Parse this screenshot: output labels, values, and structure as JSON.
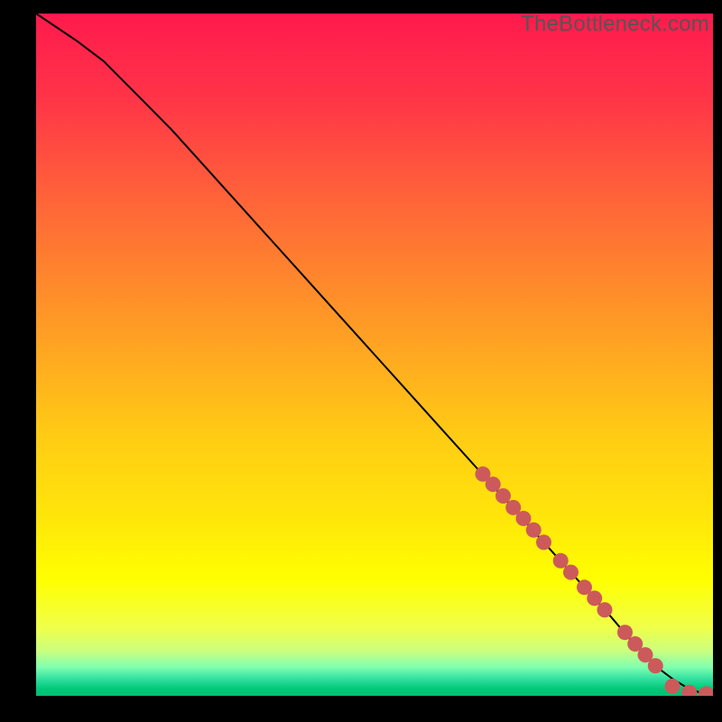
{
  "watermark": "TheBottleneck.com",
  "gradient_stops": [
    {
      "offset": 0.0,
      "color": "#ff1a4d"
    },
    {
      "offset": 0.12,
      "color": "#ff3348"
    },
    {
      "offset": 0.28,
      "color": "#ff6638"
    },
    {
      "offset": 0.45,
      "color": "#ff9926"
    },
    {
      "offset": 0.62,
      "color": "#ffcc14"
    },
    {
      "offset": 0.74,
      "color": "#ffe60a"
    },
    {
      "offset": 0.83,
      "color": "#ffff00"
    },
    {
      "offset": 0.9,
      "color": "#f0ff4a"
    },
    {
      "offset": 0.935,
      "color": "#c8ff80"
    },
    {
      "offset": 0.958,
      "color": "#80ffb0"
    },
    {
      "offset": 0.975,
      "color": "#33e0a0"
    },
    {
      "offset": 0.99,
      "color": "#00c878"
    },
    {
      "offset": 1.0,
      "color": "#00bf73"
    }
  ],
  "chart_data": {
    "type": "line",
    "title": "",
    "xlabel": "",
    "ylabel": "",
    "xlim": [
      0,
      100
    ],
    "ylim": [
      0,
      100
    ],
    "series": [
      {
        "name": "curve",
        "x": [
          0,
          3,
          6,
          10,
          15,
          20,
          25,
          30,
          35,
          40,
          45,
          50,
          55,
          60,
          65,
          70,
          75,
          80,
          85,
          88,
          90,
          92,
          94,
          96,
          98,
          100
        ],
        "y": [
          100,
          98,
          96,
          93,
          88,
          83,
          77.5,
          72,
          66.5,
          61,
          55.5,
          50,
          44.5,
          39,
          33.5,
          28,
          22.5,
          17,
          11.5,
          8,
          6,
          4,
          2.5,
          1.3,
          0.5,
          0.2
        ]
      }
    ],
    "markers": [
      {
        "x": 66,
        "y": 32.5
      },
      {
        "x": 67.5,
        "y": 31
      },
      {
        "x": 69,
        "y": 29.3
      },
      {
        "x": 70.5,
        "y": 27.6
      },
      {
        "x": 72,
        "y": 26
      },
      {
        "x": 73.5,
        "y": 24.3
      },
      {
        "x": 75,
        "y": 22.5
      },
      {
        "x": 77.5,
        "y": 19.8
      },
      {
        "x": 79,
        "y": 18.1
      },
      {
        "x": 81,
        "y": 15.9
      },
      {
        "x": 82.5,
        "y": 14.3
      },
      {
        "x": 84,
        "y": 12.6
      },
      {
        "x": 87,
        "y": 9.3
      },
      {
        "x": 88.5,
        "y": 7.6
      },
      {
        "x": 90,
        "y": 6
      },
      {
        "x": 91.5,
        "y": 4.4
      },
      {
        "x": 94,
        "y": 1.4
      },
      {
        "x": 96.5,
        "y": 0.5
      },
      {
        "x": 99,
        "y": 0.3
      }
    ],
    "marker_color": "#cc5a5a",
    "curve_color": "#000000"
  }
}
